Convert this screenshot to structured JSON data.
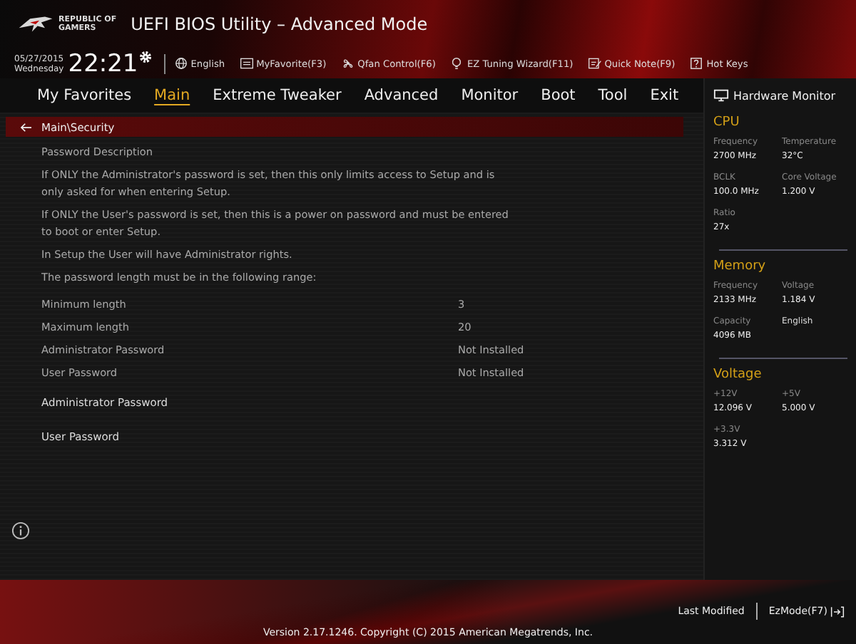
{
  "window": {
    "logo_lines": [
      "REPUBLIC OF",
      "GAMERS"
    ],
    "title": "UEFI BIOS Utility – Advanced Mode"
  },
  "clock": {
    "date": "05/27/2015",
    "weekday": "Wednesday",
    "time": "22:21"
  },
  "toolbar": [
    {
      "kind": "globe",
      "label": "English"
    },
    {
      "kind": "list",
      "label": "MyFavorite(F3)"
    },
    {
      "kind": "fan",
      "label": "Qfan Control(F6)"
    },
    {
      "kind": "bulb",
      "label": "EZ Tuning Wizard(F11)"
    },
    {
      "kind": "note",
      "label": "Quick Note(F9)"
    },
    {
      "kind": "help",
      "label": "Hot Keys"
    }
  ],
  "tabs": [
    {
      "label": "My Favorites",
      "selected": false
    },
    {
      "label": "Main",
      "selected": true
    },
    {
      "label": "Extreme Tweaker",
      "selected": false
    },
    {
      "label": "Advanced",
      "selected": false
    },
    {
      "label": "Monitor",
      "selected": false
    },
    {
      "label": "Boot",
      "selected": false
    },
    {
      "label": "Tool",
      "selected": false
    },
    {
      "label": "Exit",
      "selected": false
    }
  ],
  "breadcrumb": "Main\\Security",
  "items": [
    {
      "kind": "text",
      "label": "Password Description"
    },
    {
      "kind": "text",
      "label": "If ONLY the Administrator's password is set, then this only limits access to Setup and is only asked for when entering Setup."
    },
    {
      "kind": "text",
      "label": "If ONLY the User's password is set, then this is a power on password and must be entered to boot or enter Setup."
    },
    {
      "kind": "text",
      "label": "In Setup the User will have Administrator rights."
    },
    {
      "kind": "text",
      "label": "The password length must be in the following range:"
    },
    {
      "kind": "setting",
      "label": "Minimum length",
      "value": "3"
    },
    {
      "kind": "setting",
      "label": "Maximum length",
      "value": "20"
    },
    {
      "kind": "setting",
      "label": "Administrator Password",
      "value": "Not Installed"
    },
    {
      "kind": "setting",
      "label": "User Password",
      "value": "Not Installed"
    },
    {
      "kind": "action",
      "label": "Administrator Password"
    },
    {
      "kind": "action",
      "label": "User Password"
    }
  ],
  "hardware_monitor": {
    "title": "Hardware Monitor",
    "sections": [
      {
        "title": "CPU",
        "items": [
          {
            "label": "Frequency",
            "value": "2700 MHz"
          },
          {
            "label": "Temperature",
            "value": "32°C"
          },
          {
            "label": "BCLK",
            "value": "100.0 MHz"
          },
          {
            "label": "Core Voltage",
            "value": "1.200 V"
          },
          {
            "label": "Ratio",
            "value": "27x"
          }
        ]
      },
      {
        "title": "Memory",
        "items": [
          {
            "label": "Frequency",
            "value": "2133 MHz"
          },
          {
            "label": "Voltage",
            "value": "1.184 V"
          },
          {
            "label": "Capacity",
            "value": "4096 MB"
          },
          {
            "label": "English"
          }
        ]
      },
      {
        "title": "Voltage",
        "items": [
          {
            "label": "+12V",
            "value": "12.096 V"
          },
          {
            "label": "+5V",
            "value": "5.000 V"
          },
          {
            "label": "+3.3V",
            "value": "3.312 V"
          }
        ]
      }
    ]
  },
  "footer": {
    "last_modified": "Last Modified",
    "ez_mode": "EzMode(F7)",
    "version": "Version 2.17.1246. Copyright (C) 2015 American Megatrends, Inc."
  }
}
